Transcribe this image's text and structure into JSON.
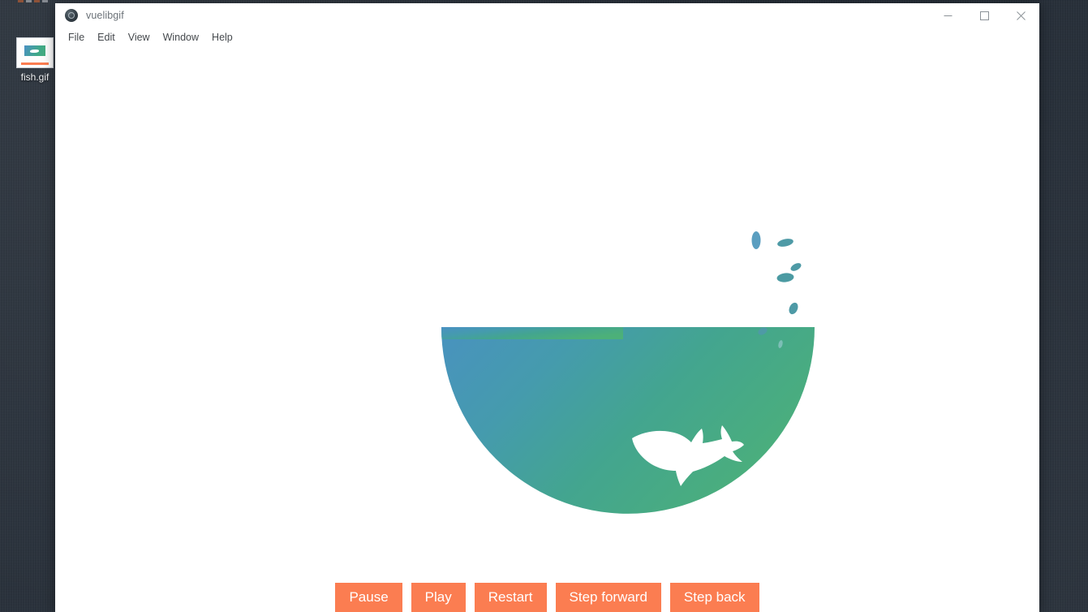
{
  "desktop": {
    "icon": {
      "name": "fish.gif",
      "icon_glyph": "gif-file-thumbnail-icon"
    },
    "background_color": "#2a323c"
  },
  "window": {
    "title": "vuelibgif",
    "app_icon": "electron-app-icon",
    "controls": {
      "minimize": "minimize-icon",
      "maximize": "maximize-icon",
      "close": "close-icon"
    },
    "menu": [
      {
        "label": "File"
      },
      {
        "label": "Edit"
      },
      {
        "label": "View"
      },
      {
        "label": "Window"
      },
      {
        "label": "Help"
      }
    ],
    "buttons": [
      {
        "label": "Pause",
        "name": "pause-button"
      },
      {
        "label": "Play",
        "name": "play-button"
      },
      {
        "label": "Restart",
        "name": "restart-button"
      },
      {
        "label": "Step forward",
        "name": "step-forward-button"
      },
      {
        "label": "Step back",
        "name": "step-back-button"
      }
    ],
    "media": {
      "alt": "Animated GIF of a fish swimming in a gradient bowl of water with splashing droplets",
      "bowl_gradient_start": "#4a90c4",
      "bowl_gradient_end": "#4bb07a",
      "fish_color": "#ffffff",
      "droplet_color": "#4e9aa6",
      "droplet_top_color": "#5a9ec0",
      "canvas_background": "#ffffff"
    }
  },
  "theme": {
    "accent": "#fb7d51",
    "window_chrome": "#ffffff",
    "menu_text": "#45494d",
    "title_text": "#6b7278"
  }
}
